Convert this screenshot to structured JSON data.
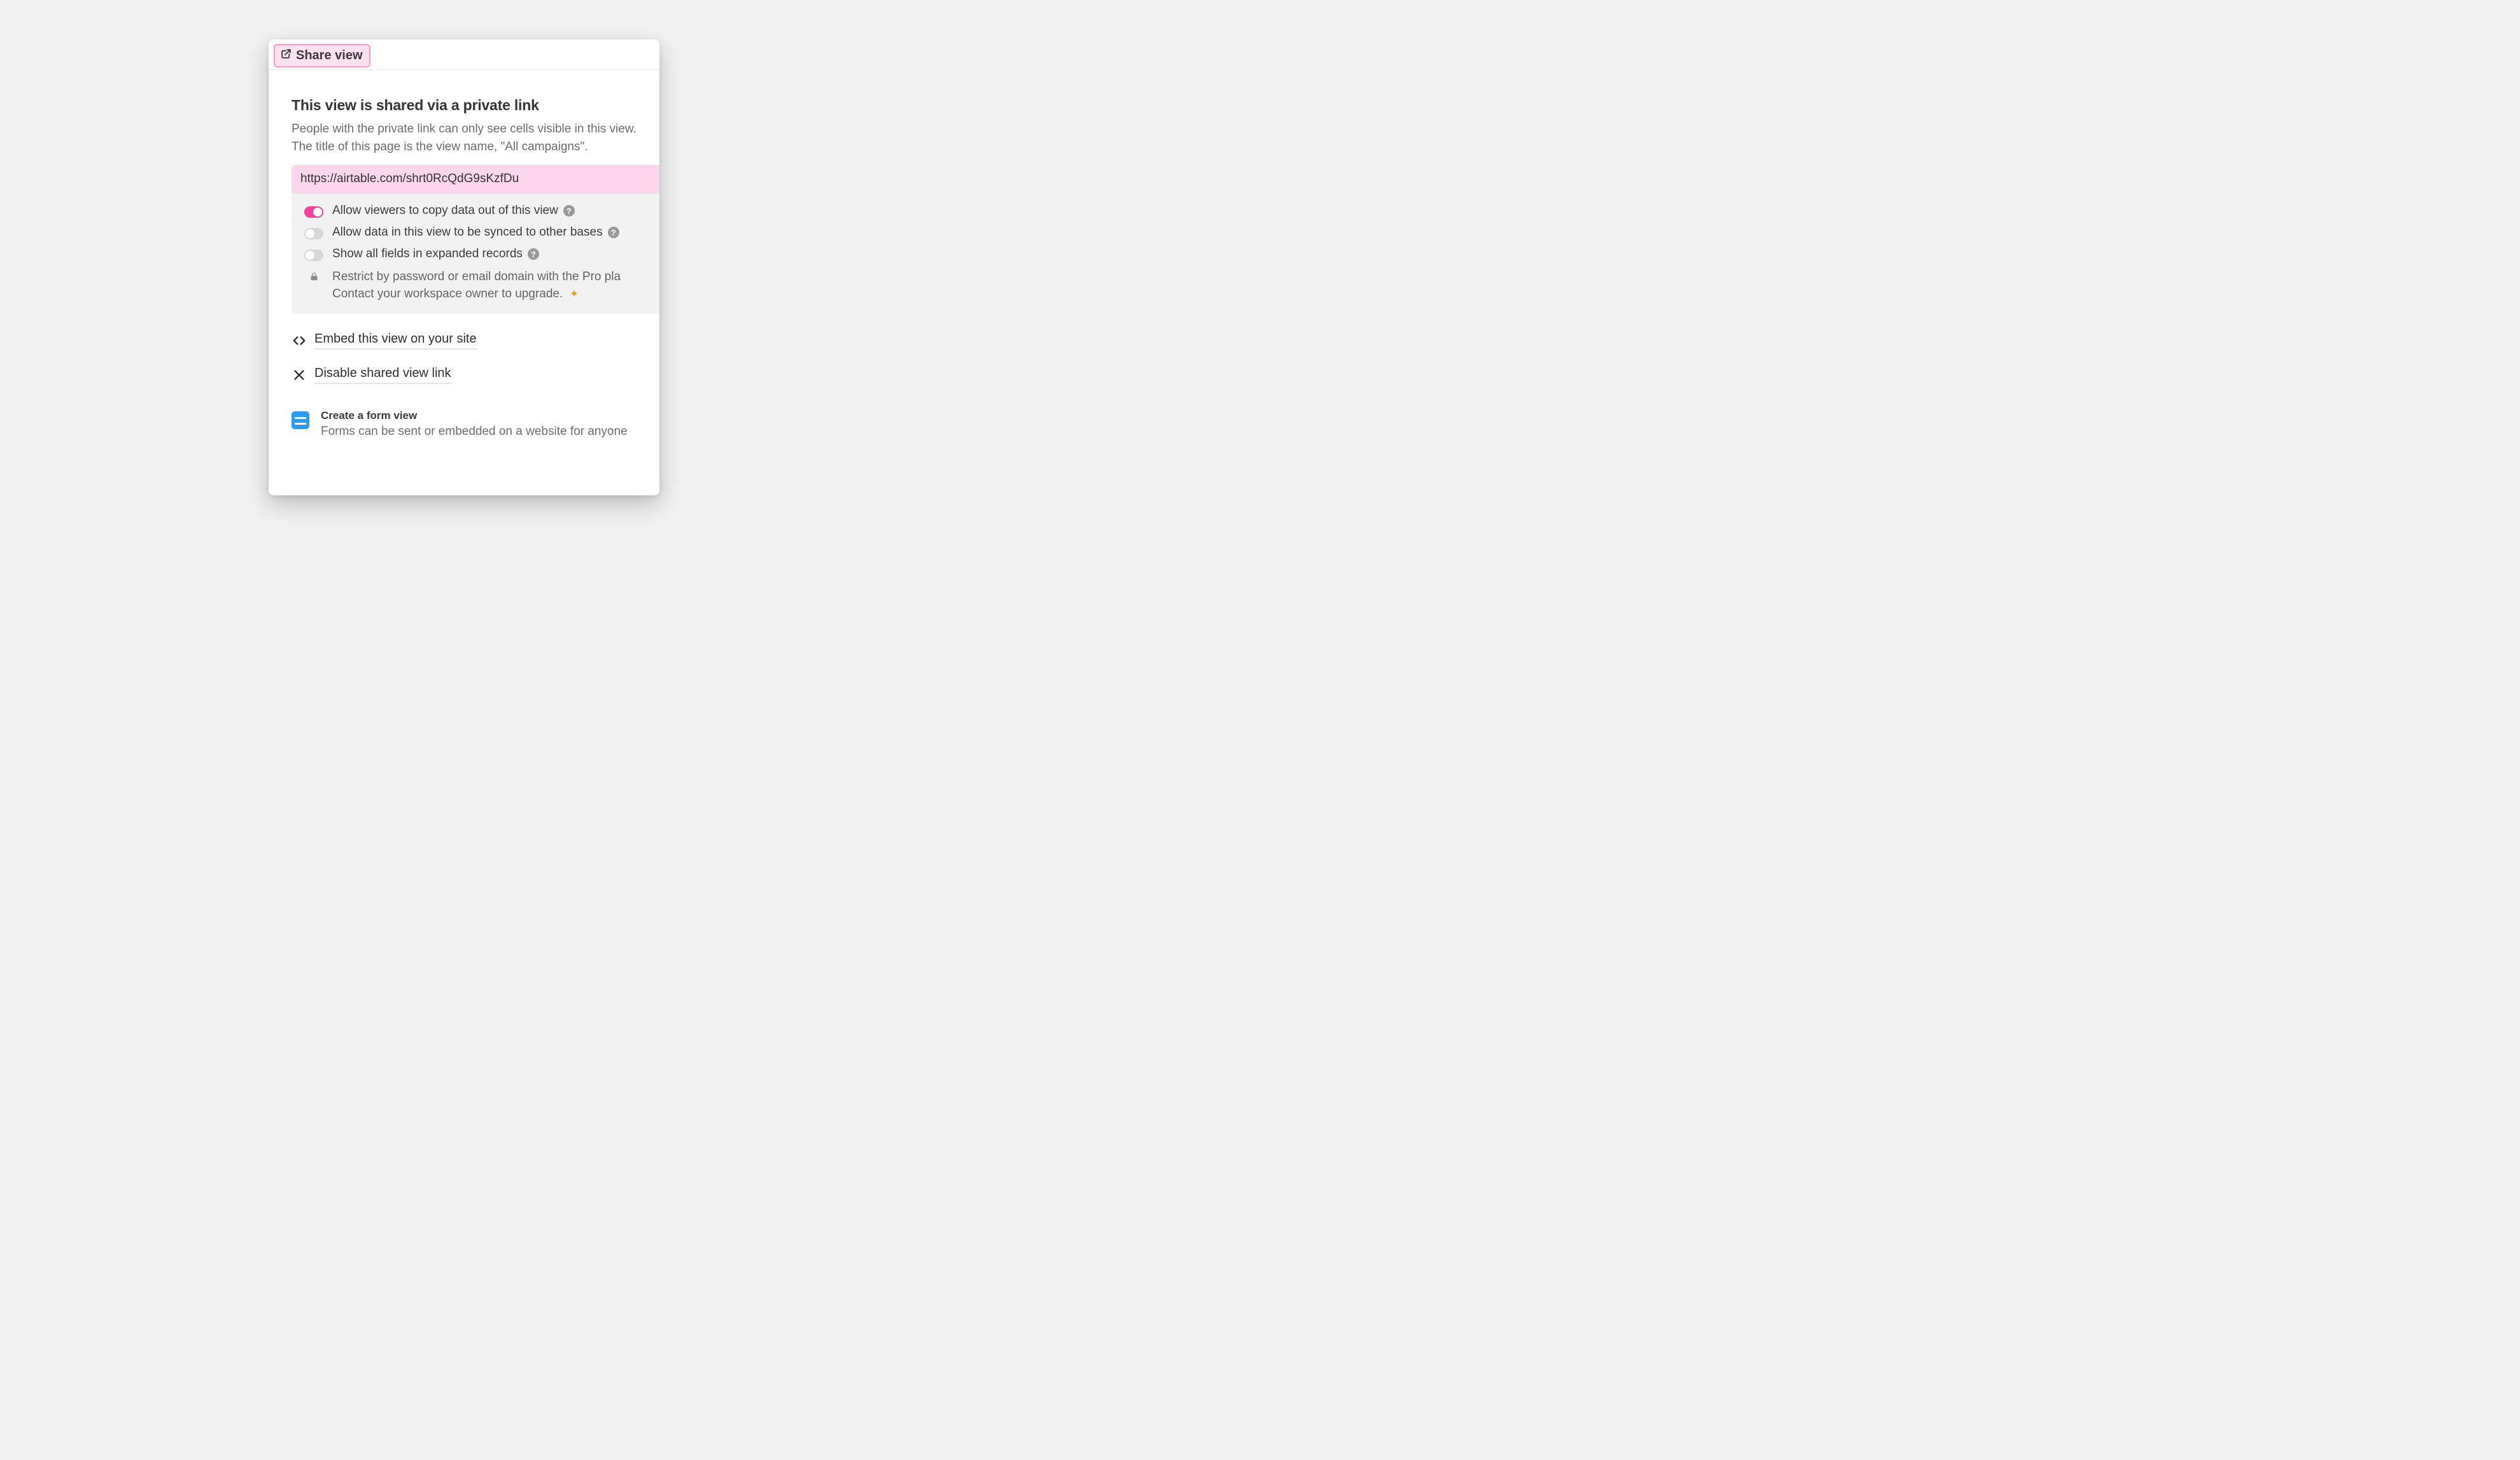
{
  "tab": {
    "label": "Share view"
  },
  "main": {
    "heading": "This view is shared via a private link",
    "description": "People with the private link can only see cells visible in this view. The title of this page is the view name, \"All campaigns\".",
    "url": "https://airtable.com/shrt0RcQdG9sKzfDu",
    "options": {
      "allow_copy": {
        "label": "Allow viewers to copy data out of this view",
        "on": true
      },
      "allow_sync": {
        "label": "Allow data in this view to be synced to other bases",
        "on": false
      },
      "show_all_fields": {
        "label": "Show all fields in expanded records",
        "on": false
      },
      "restrict": {
        "text": "Restrict by password or email domain with the Pro plan. Contact your workspace owner to upgrade."
      }
    },
    "embed": "Embed this view on your site",
    "disable": "Disable shared view link",
    "form": {
      "title": "Create a form view",
      "desc": "Forms can be sent or embedded on a website for anyone"
    }
  }
}
